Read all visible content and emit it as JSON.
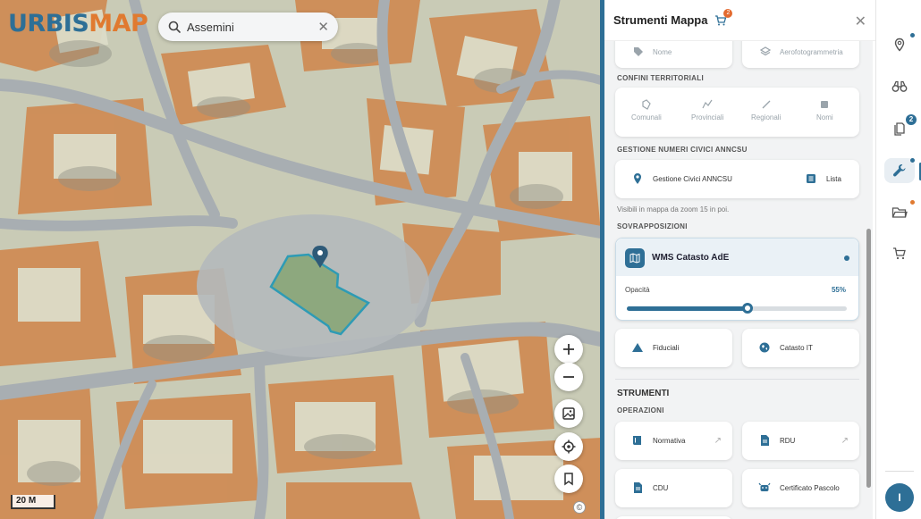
{
  "brand": {
    "part1": "URBIS",
    "part2": "MAP"
  },
  "search": {
    "value": "Assemini",
    "placeholder": "Cerca"
  },
  "map": {
    "scale_label": "20 M",
    "attribution_label": "©"
  },
  "panel": {
    "title": "Strumenti Mappa",
    "cart_badge": "2",
    "top_tiles": [
      {
        "label": "Nome",
        "icon": "tag-icon"
      },
      {
        "label": "Aerofotogrammetria",
        "icon": "layers-icon"
      }
    ],
    "confini": {
      "title": "CONFINI TERRITORIALI",
      "items": [
        {
          "label": "Comunali",
          "icon": "boundary-icon"
        },
        {
          "label": "Provinciali",
          "icon": "boundary-icon"
        },
        {
          "label": "Regionali",
          "icon": "line-icon"
        },
        {
          "label": "Nomi",
          "icon": "list-icon"
        }
      ]
    },
    "civici": {
      "title": "GESTIONE NUMERI CIVICI ANNCSU",
      "gestione_label": "Gestione Civici ANNCSU",
      "lista_label": "Lista",
      "hint": "Visibili in mappa da zoom 15 in poi."
    },
    "sovrapposizioni": {
      "title": "SOVRAPPOSIZIONI",
      "wms_label": "WMS Catasto AdE",
      "opacity_label": "Opacità",
      "opacity_value": "55%",
      "opacity_fraction": 0.55,
      "fiduciali_label": "Fiduciali",
      "catasto_label": "Catasto IT"
    },
    "strumenti": {
      "title": "STRUMENTI",
      "operazioni_title": "OPERAZIONI",
      "items": [
        {
          "label": "Normativa",
          "icon": "book-icon",
          "external": true
        },
        {
          "label": "RDU",
          "icon": "document-icon",
          "external": true
        },
        {
          "label": "CDU",
          "icon": "document-icon",
          "external": false
        },
        {
          "label": "Certificato Pascolo",
          "icon": "cow-icon",
          "external": false
        }
      ]
    }
  },
  "rail": {
    "documents_badge": "2",
    "avatar_initial": "I"
  },
  "colors": {
    "accent": "#2e6f96",
    "orange": "#e07a30",
    "badge": "#e36a2f"
  }
}
